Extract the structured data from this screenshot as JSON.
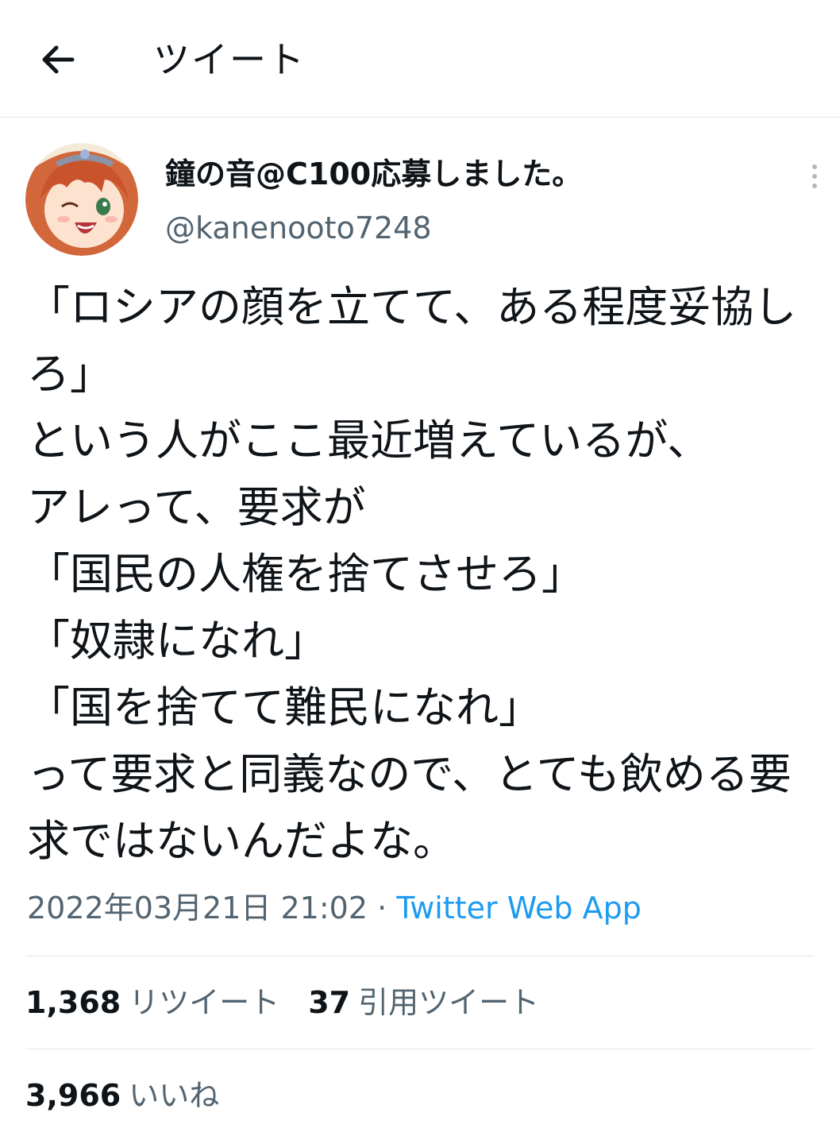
{
  "header": {
    "title": "ツイート",
    "back_icon": "arrow-left-icon"
  },
  "tweet": {
    "display_name": "鐘の音@C100応募しました。",
    "handle": "@kanenooto7248",
    "body": "「ロシアの顔を立てて、ある程度妥協しろ」\nという人がここ最近増えているが、\nアレって、要求が\n「国民の人権を捨てさせろ」\n「奴隷になれ」\n「国を捨てて難民になれ」\nって要求と同義なので、とても飲める要求ではないんだよな。",
    "timestamp": "2022年03月21日 21:02",
    "separator": " · ",
    "source": "Twitter Web App"
  },
  "stats": {
    "retweets_count": "1,368",
    "retweets_label": "リツイート",
    "quotes_count": "37",
    "quotes_label": "引用ツイート",
    "likes_count": "3,966",
    "likes_label": "いいね"
  },
  "colors": {
    "link": "#1d9bf0",
    "secondary_text": "#536471",
    "divider": "#e1e8ed"
  }
}
